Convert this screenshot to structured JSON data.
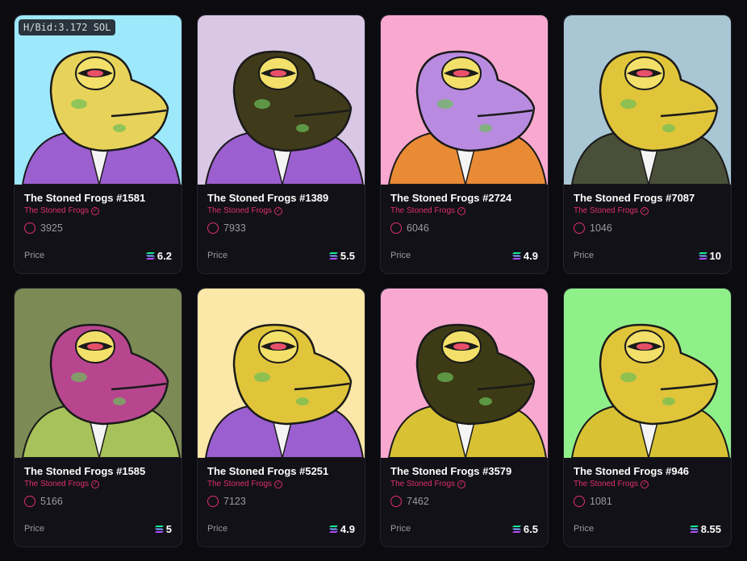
{
  "badge": "H/Bid:3.172 SOL",
  "price_label": "Price",
  "colors": {
    "background": "#0b0b10",
    "card": "#111117",
    "accent": "#e0306a"
  },
  "cards": [
    {
      "title": "The Stoned Frogs #1581",
      "collection": "The Stoned Frogs",
      "rank": "3925",
      "price": "6.2",
      "art_bg": "#9ee8fb",
      "skin": "#e8d35a",
      "shirt": "#9b5fd0"
    },
    {
      "title": "The Stoned Frogs #1389",
      "collection": "The Stoned Frogs",
      "rank": "7933",
      "price": "5.5",
      "art_bg": "#d9c7e6",
      "skin": "#3f3a1a",
      "shirt": "#9b5fd0"
    },
    {
      "title": "The Stoned Frogs #2724",
      "collection": "The Stoned Frogs",
      "rank": "6046",
      "price": "4.9",
      "art_bg": "#f9a9d0",
      "skin": "#b98be0",
      "shirt": "#e98a35"
    },
    {
      "title": "The Stoned Frogs #7087",
      "collection": "The Stoned Frogs",
      "rank": "1046",
      "price": "10",
      "art_bg": "#a8c6d4",
      "skin": "#e0c53a",
      "shirt": "#4a4f3a"
    },
    {
      "title": "The Stoned Frogs #1585",
      "collection": "The Stoned Frogs",
      "rank": "5166",
      "price": "5",
      "art_bg": "#7c8a55",
      "skin": "#b8468f",
      "shirt": "#a7c25a"
    },
    {
      "title": "The Stoned Frogs #5251",
      "collection": "The Stoned Frogs",
      "rank": "7123",
      "price": "4.9",
      "art_bg": "#fbe7a8",
      "skin": "#e0c53a",
      "shirt": "#9b5fd0"
    },
    {
      "title": "The Stoned Frogs #3579",
      "collection": "The Stoned Frogs",
      "rank": "7462",
      "price": "6.5",
      "art_bg": "#f9a9d0",
      "skin": "#3d3a16",
      "shirt": "#d8c234"
    },
    {
      "title": "The Stoned Frogs #946",
      "collection": "The Stoned Frogs",
      "rank": "1081",
      "price": "8.55",
      "art_bg": "#8ff08a",
      "skin": "#e0c53a",
      "shirt": "#d8c234"
    }
  ]
}
